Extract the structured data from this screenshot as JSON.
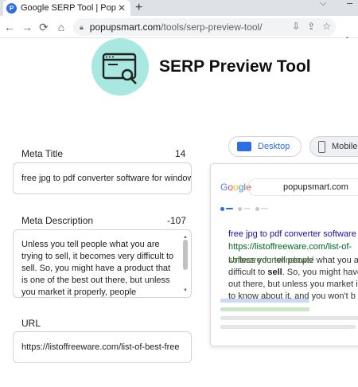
{
  "browser": {
    "tab_title": "Google SERP Tool | Popupsmart",
    "tab_favicon": "P",
    "tab_close": "✕",
    "new_tab": "+",
    "url_host": "popupsmart.com",
    "url_path": "/tools/serp-preview-tool/"
  },
  "header": {
    "title": "SERP Preview Tool"
  },
  "form": {
    "meta_title_label": "Meta Title",
    "meta_title_count": "14",
    "meta_title_value": "free jpg to pdf converter software for windows",
    "meta_desc_label": "Meta Description",
    "meta_desc_count": "-107",
    "meta_desc_value": "Unless you tell people what you are trying to sell, it becomes very difficult to sell. So, you might have a product that is one of the best out there, but unless you market it properly, people",
    "url_label": "URL",
    "url_value": "https://listoffreeware.com/list-of-best-free"
  },
  "view_toggle": {
    "desktop_label": "Desktop",
    "mobile_label": "Mobile"
  },
  "preview": {
    "google_logo": "Google",
    "search_query": "popupsmart.com",
    "result_title": "free jpg to pdf converter software",
    "result_url": "https://listoffreeware.com/list-of-",
    "result_overlap": "software-for-windows/",
    "result_desc_1": "Unless you tell people what you a",
    "result_desc_2_pre": "difficult to ",
    "result_desc_2_bold": "sell",
    "result_desc_2_post": ". So, you might have",
    "result_desc_3": "out there, but unless you market i",
    "result_desc_4": "to know about it, and you won't b"
  },
  "colors": {
    "accent": "#2b6ee6",
    "hero_circle": "#a9e8e1",
    "link": "#1a0dab",
    "url_green": "#006621"
  }
}
